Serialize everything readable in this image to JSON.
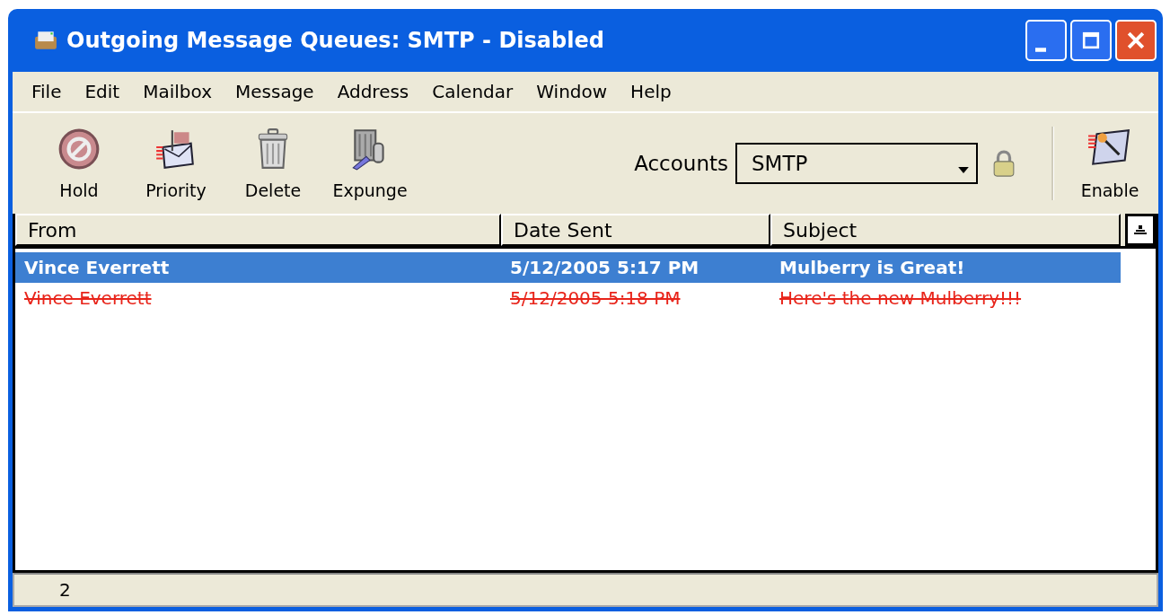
{
  "window": {
    "title": "Outgoing Message Queues: SMTP - Disabled"
  },
  "menu": [
    "File",
    "Edit",
    "Mailbox",
    "Message",
    "Address",
    "Calendar",
    "Window",
    "Help"
  ],
  "toolbar": [
    {
      "label": "Hold",
      "kind": "hold"
    },
    {
      "label": "Priority",
      "kind": "priority"
    },
    {
      "label": "Delete",
      "kind": "delete"
    },
    {
      "label": "Expunge",
      "kind": "expunge"
    }
  ],
  "accounts": {
    "label": "Accounts",
    "value": "SMTP",
    "locked": true
  },
  "enable_button": {
    "label": "Enable"
  },
  "table": {
    "columns": [
      "From",
      "Date Sent",
      "Subject"
    ],
    "rows": [
      {
        "from": "Vince Everrett",
        "date_sent": "5/12/2005 5:17 PM",
        "subject": "Mulberry is Great!",
        "selected": true,
        "deleted": false
      },
      {
        "from": "Vince Everrett",
        "date_sent": "5/12/2005 5:18 PM",
        "subject": "Here's the new Mulberry!!!",
        "selected": false,
        "deleted": true
      }
    ]
  },
  "status_bar": {
    "count": "2"
  }
}
